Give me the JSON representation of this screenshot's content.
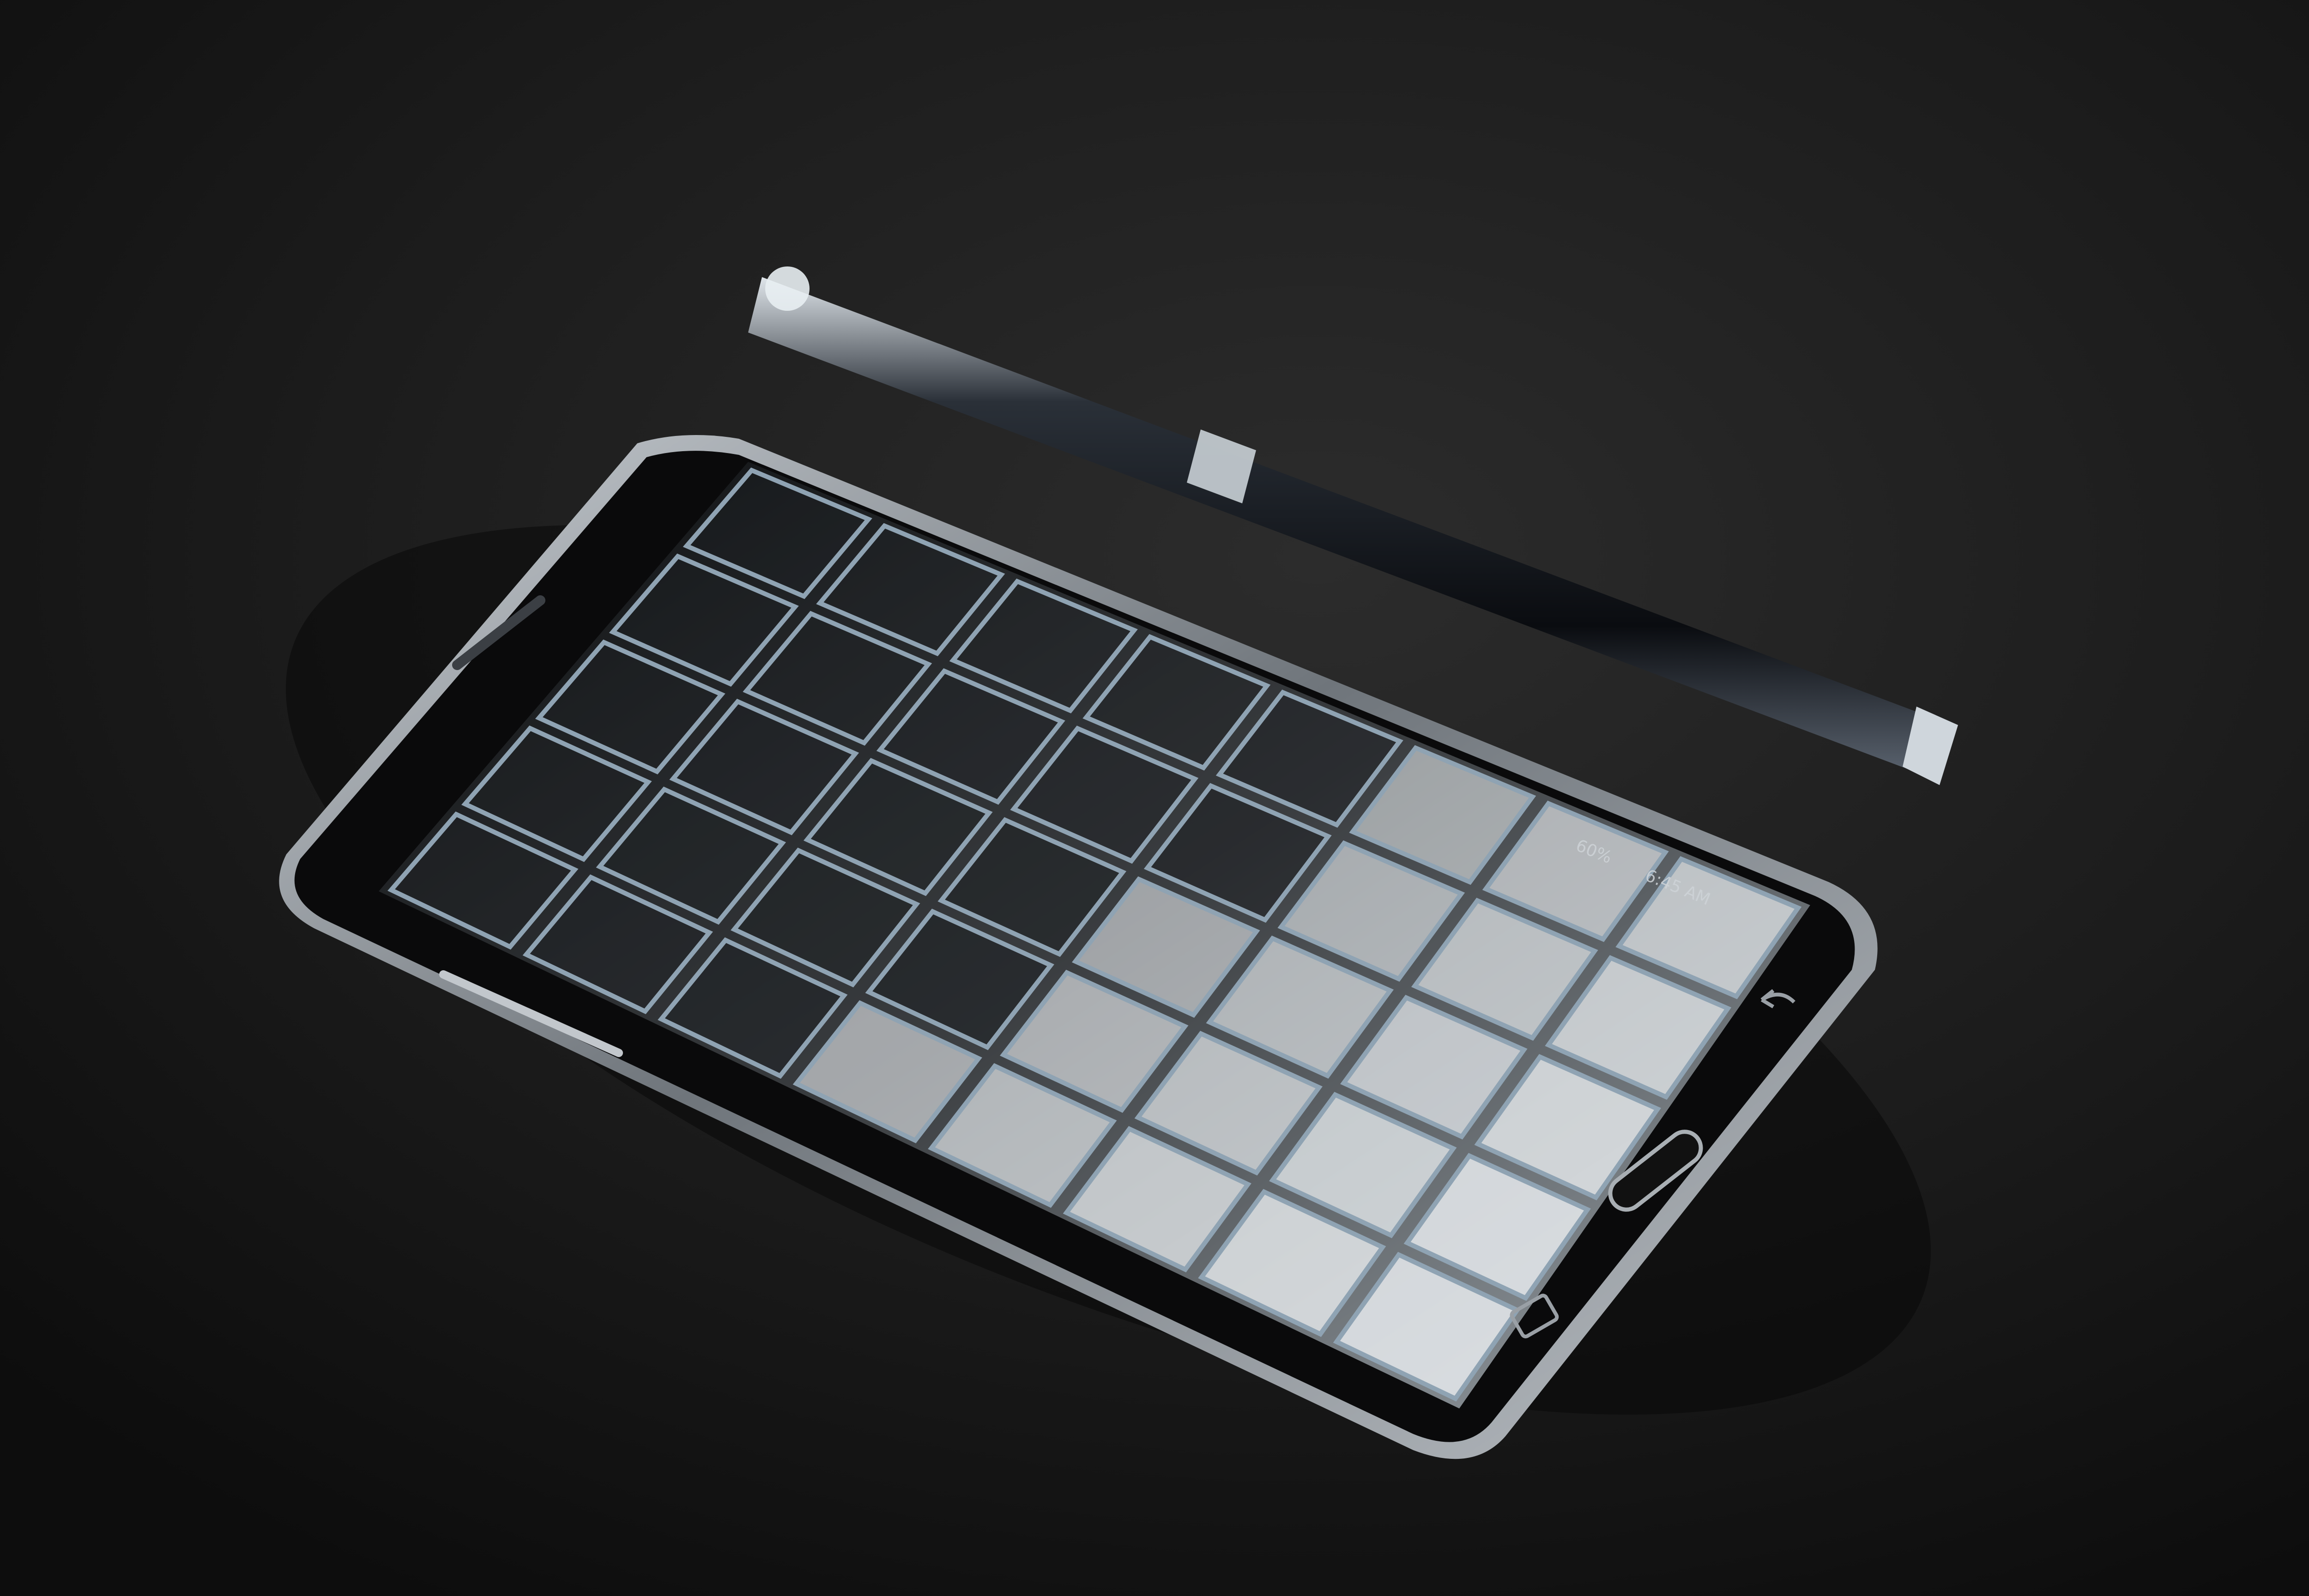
{
  "scene": {
    "description_tags": [
      "smartphone",
      "stylus-pen",
      "dark-table"
    ],
    "colors": {
      "background": "#161616",
      "table_highlight": "#2a2a2a",
      "phone_body": "#0a0a0b",
      "phone_frame": "#9aa0a6",
      "screen_tile_light": "#e6eaed",
      "screen_tile_dark": "#1c1f22",
      "screen_grid_line": "#8fa3b3",
      "pen_body": "#0c0f14",
      "pen_chrome": "#d7dde3"
    }
  },
  "phone": {
    "status_bar": {
      "battery": "60%",
      "time": "6:45 AM"
    },
    "nav_buttons": [
      "back-button",
      "home-button",
      "recents-button"
    ]
  }
}
